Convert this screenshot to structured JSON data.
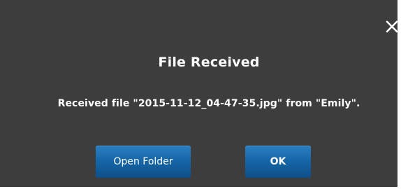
{
  "dialog": {
    "title": "File Received",
    "message": "Received file \"2015-11-12_04-47-35.jpg\" from \"Emily\".",
    "buttons": {
      "open_folder": "Open Folder",
      "ok": "OK"
    },
    "close_icon": "close-icon"
  },
  "colors": {
    "background": "#3d3d3d",
    "button": "#1565a6",
    "text": "#ffffff"
  }
}
